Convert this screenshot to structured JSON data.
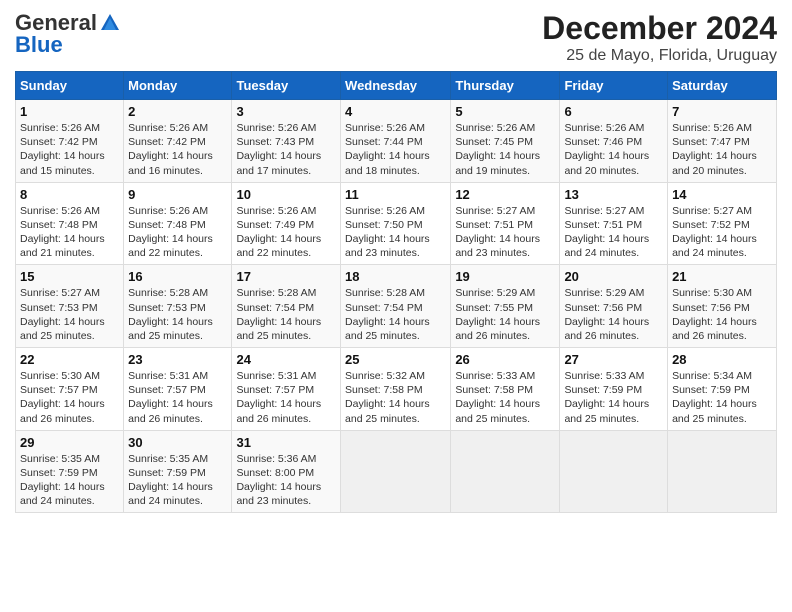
{
  "logo": {
    "general": "General",
    "blue": "Blue"
  },
  "title": "December 2024",
  "subtitle": "25 de Mayo, Florida, Uruguay",
  "weekdays": [
    "Sunday",
    "Monday",
    "Tuesday",
    "Wednesday",
    "Thursday",
    "Friday",
    "Saturday"
  ],
  "weeks": [
    [
      {
        "day": "1",
        "sunrise": "5:26 AM",
        "sunset": "7:42 PM",
        "daylight": "14 hours and 15 minutes."
      },
      {
        "day": "2",
        "sunrise": "5:26 AM",
        "sunset": "7:42 PM",
        "daylight": "14 hours and 16 minutes."
      },
      {
        "day": "3",
        "sunrise": "5:26 AM",
        "sunset": "7:43 PM",
        "daylight": "14 hours and 17 minutes."
      },
      {
        "day": "4",
        "sunrise": "5:26 AM",
        "sunset": "7:44 PM",
        "daylight": "14 hours and 18 minutes."
      },
      {
        "day": "5",
        "sunrise": "5:26 AM",
        "sunset": "7:45 PM",
        "daylight": "14 hours and 19 minutes."
      },
      {
        "day": "6",
        "sunrise": "5:26 AM",
        "sunset": "7:46 PM",
        "daylight": "14 hours and 20 minutes."
      },
      {
        "day": "7",
        "sunrise": "5:26 AM",
        "sunset": "7:47 PM",
        "daylight": "14 hours and 20 minutes."
      }
    ],
    [
      {
        "day": "8",
        "sunrise": "5:26 AM",
        "sunset": "7:48 PM",
        "daylight": "14 hours and 21 minutes."
      },
      {
        "day": "9",
        "sunrise": "5:26 AM",
        "sunset": "7:48 PM",
        "daylight": "14 hours and 22 minutes."
      },
      {
        "day": "10",
        "sunrise": "5:26 AM",
        "sunset": "7:49 PM",
        "daylight": "14 hours and 22 minutes."
      },
      {
        "day": "11",
        "sunrise": "5:26 AM",
        "sunset": "7:50 PM",
        "daylight": "14 hours and 23 minutes."
      },
      {
        "day": "12",
        "sunrise": "5:27 AM",
        "sunset": "7:51 PM",
        "daylight": "14 hours and 23 minutes."
      },
      {
        "day": "13",
        "sunrise": "5:27 AM",
        "sunset": "7:51 PM",
        "daylight": "14 hours and 24 minutes."
      },
      {
        "day": "14",
        "sunrise": "5:27 AM",
        "sunset": "7:52 PM",
        "daylight": "14 hours and 24 minutes."
      }
    ],
    [
      {
        "day": "15",
        "sunrise": "5:27 AM",
        "sunset": "7:53 PM",
        "daylight": "14 hours and 25 minutes."
      },
      {
        "day": "16",
        "sunrise": "5:28 AM",
        "sunset": "7:53 PM",
        "daylight": "14 hours and 25 minutes."
      },
      {
        "day": "17",
        "sunrise": "5:28 AM",
        "sunset": "7:54 PM",
        "daylight": "14 hours and 25 minutes."
      },
      {
        "day": "18",
        "sunrise": "5:28 AM",
        "sunset": "7:54 PM",
        "daylight": "14 hours and 25 minutes."
      },
      {
        "day": "19",
        "sunrise": "5:29 AM",
        "sunset": "7:55 PM",
        "daylight": "14 hours and 26 minutes."
      },
      {
        "day": "20",
        "sunrise": "5:29 AM",
        "sunset": "7:56 PM",
        "daylight": "14 hours and 26 minutes."
      },
      {
        "day": "21",
        "sunrise": "5:30 AM",
        "sunset": "7:56 PM",
        "daylight": "14 hours and 26 minutes."
      }
    ],
    [
      {
        "day": "22",
        "sunrise": "5:30 AM",
        "sunset": "7:57 PM",
        "daylight": "14 hours and 26 minutes."
      },
      {
        "day": "23",
        "sunrise": "5:31 AM",
        "sunset": "7:57 PM",
        "daylight": "14 hours and 26 minutes."
      },
      {
        "day": "24",
        "sunrise": "5:31 AM",
        "sunset": "7:57 PM",
        "daylight": "14 hours and 26 minutes."
      },
      {
        "day": "25",
        "sunrise": "5:32 AM",
        "sunset": "7:58 PM",
        "daylight": "14 hours and 25 minutes."
      },
      {
        "day": "26",
        "sunrise": "5:33 AM",
        "sunset": "7:58 PM",
        "daylight": "14 hours and 25 minutes."
      },
      {
        "day": "27",
        "sunrise": "5:33 AM",
        "sunset": "7:59 PM",
        "daylight": "14 hours and 25 minutes."
      },
      {
        "day": "28",
        "sunrise": "5:34 AM",
        "sunset": "7:59 PM",
        "daylight": "14 hours and 25 minutes."
      }
    ],
    [
      {
        "day": "29",
        "sunrise": "5:35 AM",
        "sunset": "7:59 PM",
        "daylight": "14 hours and 24 minutes."
      },
      {
        "day": "30",
        "sunrise": "5:35 AM",
        "sunset": "7:59 PM",
        "daylight": "14 hours and 24 minutes."
      },
      {
        "day": "31",
        "sunrise": "5:36 AM",
        "sunset": "8:00 PM",
        "daylight": "14 hours and 23 minutes."
      },
      null,
      null,
      null,
      null
    ]
  ]
}
